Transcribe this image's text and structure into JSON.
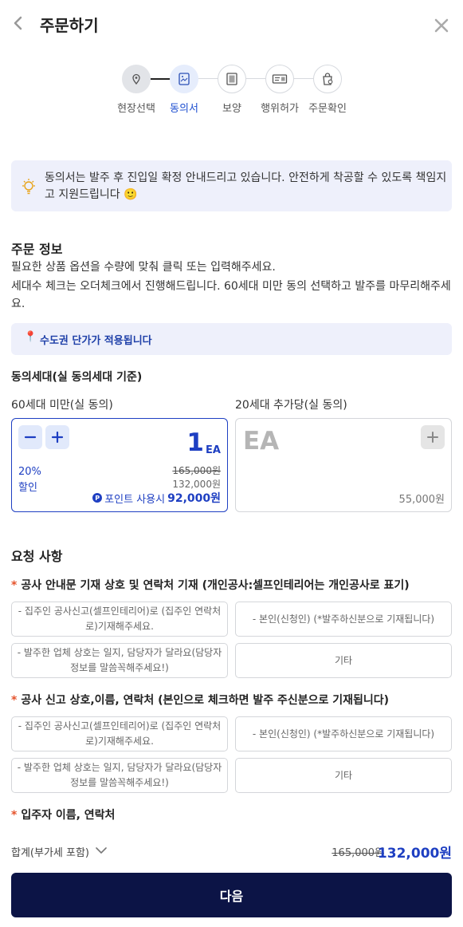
{
  "header": {
    "title": "주문하기"
  },
  "steps": [
    {
      "label": "현장선택",
      "icon": "location-pin-icon",
      "state": "done"
    },
    {
      "label": "동의서",
      "icon": "document-image-icon",
      "state": "current"
    },
    {
      "label": "보양",
      "icon": "protection-panel-icon",
      "state": "todo"
    },
    {
      "label": "행위허가",
      "icon": "permit-card-icon",
      "state": "todo"
    },
    {
      "label": "주문확인",
      "icon": "order-bag-icon",
      "state": "todo"
    }
  ],
  "notice": {
    "text": "동의서는 발주 후 진입일 확정 안내드리고 있습니다. 안전하게 착공할 수 있도록 책임지고 지원드립니다 🙂"
  },
  "order_info": {
    "title": "주문 정보",
    "desc1": "필요한 상품 옵션을 수량에 맞춰 클릭 또는 입력해주세요.",
    "desc2": "세대수 체크는 오더체크에서 진행해드립니다. 60세대 미만 동의 선택하고 발주를 마무리해주세요.",
    "region_text": "수도권 단가가 적용됩니다"
  },
  "consent": {
    "title": "동의세대(실 동의세대 기준)",
    "under60": {
      "label": "60세대 미만(실 동의)",
      "qty": "1",
      "unit": "EA",
      "discount_pct": "20%",
      "discount_word": "할인",
      "original_price": "165,000원",
      "sale_price": "132,000원",
      "point_label": "포인트 사용시",
      "point_price": "92,000원"
    },
    "per20": {
      "label": "20세대 추가당(실 동의)",
      "unit": "EA",
      "price": "55,000원"
    }
  },
  "requests": {
    "title": "요청 사항",
    "q1": {
      "title": "공사 안내문 기재 상호 및 연락처 기재 (개인공사:셀프인테리어는 개인공사로 표기)",
      "options": [
        "- 집주인 공사신고(셀프인테리어)로 (집주인 연락처로)기재해주세요.",
        "- 본인(신청인) (*발주하신분으로 기재됩니다)",
        "- 발주한 업체 상호는 일지, 담당자가 달라요(담당자정보를 말씀꼭해주세요!)",
        "기타"
      ]
    },
    "q2": {
      "title": "공사 신고 상호,이름, 연락처 (본인으로 체크하면 발주 주신분으로 기재됩니다)",
      "options": [
        "- 집주인 공사신고(셀프인테리어)로 (집주인 연락처로)기재해주세요.",
        "- 본인(신청인) (*발주하신분으로 기재됩니다)",
        "- 발주한 업체 상호는 일지, 담당자가 달라요(담당자정보를 말씀꼭해주세요!)",
        "기타"
      ]
    },
    "q3": {
      "title": "입주자 이름, 연락처"
    }
  },
  "total": {
    "label": "합계(부가세 포함)",
    "original": "165,000원",
    "final": "132,000원"
  },
  "next_button": "다음",
  "colors": {
    "accent": "#1e3fc2",
    "primary_button": "#0c1446",
    "required_star": "#e5532c"
  }
}
